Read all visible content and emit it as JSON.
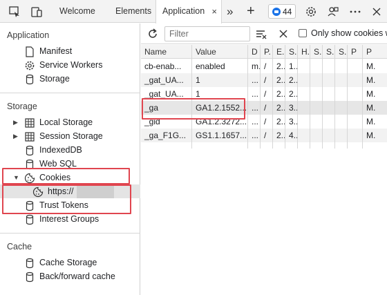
{
  "tabs": {
    "welcome": "Welcome",
    "elements": "Elements",
    "application": "Application",
    "close_glyph": "×",
    "more_glyph": "»",
    "add_glyph": "+",
    "issues_count": "44"
  },
  "sidebar": {
    "application_title": "Application",
    "application_items": [
      "Manifest",
      "Service Workers",
      "Storage"
    ],
    "storage_title": "Storage",
    "storage_items": [
      "Local Storage",
      "Session Storage",
      "IndexedDB",
      "Web SQL",
      "Cookies",
      "Trust Tokens",
      "Interest Groups"
    ],
    "cookie_origin": "https://",
    "cache_title": "Cache",
    "cache_items": [
      "Cache Storage",
      "Back/forward cache"
    ]
  },
  "toolbar": {
    "filter_placeholder": "Filter",
    "only_show_label": "Only show cookies w"
  },
  "table": {
    "columns": [
      "Name",
      "Value",
      "D",
      "P.",
      "E.",
      "S.",
      "H.",
      "S.",
      "S.",
      "S.",
      "P",
      "P"
    ],
    "rows": [
      [
        "cb-enab...",
        "enabled",
        "m.",
        "/",
        "2..",
        "1...",
        "",
        "",
        "",
        "",
        "",
        "M."
      ],
      [
        "_gat_UA...",
        "1",
        "...",
        "/",
        "2..",
        "2...",
        "",
        "",
        "",
        "",
        "",
        "M."
      ],
      [
        "_gat_UA...",
        "1",
        "...",
        "/",
        "2..",
        "2...",
        "",
        "",
        "",
        "",
        "",
        "M."
      ],
      [
        "_ga",
        "GA1.2.1552...",
        "...",
        "/",
        "2..",
        "3...",
        "",
        "",
        "",
        "",
        "",
        "M."
      ],
      [
        "_gid",
        "GA1.2.3272...",
        "...",
        "/",
        "2..",
        "3...",
        "",
        "",
        "",
        "",
        "",
        "M."
      ],
      [
        "_ga_F1G...",
        "GS1.1.1657...",
        "...",
        "/",
        "2..",
        "4...",
        "",
        "",
        "",
        "",
        "",
        "M."
      ]
    ]
  },
  "colors": {
    "highlight": "#e0454f",
    "accent": "#1a73e8"
  }
}
